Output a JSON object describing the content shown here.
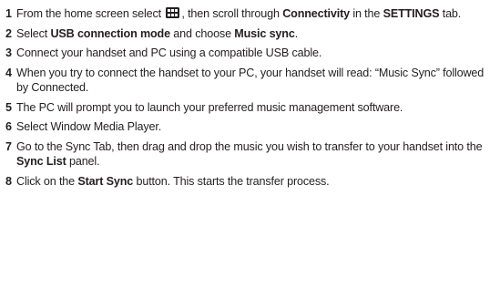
{
  "steps": [
    {
      "num": "1",
      "parts": [
        {
          "t": "From the home screen select "
        },
        {
          "icon": "menu-grid-icon"
        },
        {
          "t": ", then scroll through "
        },
        {
          "b": "Connectivity"
        },
        {
          "t": " in the "
        },
        {
          "b": "SETTINGS"
        },
        {
          "t": " tab."
        }
      ]
    },
    {
      "num": "2",
      "parts": [
        {
          "t": "Select "
        },
        {
          "b": "USB connection mode"
        },
        {
          "t": " and choose "
        },
        {
          "b": "Music sync"
        },
        {
          "t": "."
        }
      ]
    },
    {
      "num": "3",
      "parts": [
        {
          "t": "Connect your handset and PC using a compatible USB cable."
        }
      ]
    },
    {
      "num": "4",
      "parts": [
        {
          "t": "When you try to connect the handset to your PC, your handset will read: “Music Sync” followed by Connected."
        }
      ]
    },
    {
      "num": "5",
      "parts": [
        {
          "t": "The PC will prompt you to launch your preferred music management software."
        }
      ]
    },
    {
      "num": "6",
      "parts": [
        {
          "t": "Select Window Media Player."
        }
      ]
    },
    {
      "num": "7",
      "parts": [
        {
          "t": "Go to the Sync Tab, then drag and drop the music you wish to transfer to your handset into the "
        },
        {
          "b": "Sync List"
        },
        {
          "t": " panel."
        }
      ]
    },
    {
      "num": "8",
      "parts": [
        {
          "t": "Click on the "
        },
        {
          "b": "Start Sync"
        },
        {
          "t": " button. This starts the transfer process."
        }
      ]
    }
  ],
  "colors": {
    "text": "#231f20",
    "icon_fill": "#231f20",
    "icon_cell": "#ffffff"
  }
}
